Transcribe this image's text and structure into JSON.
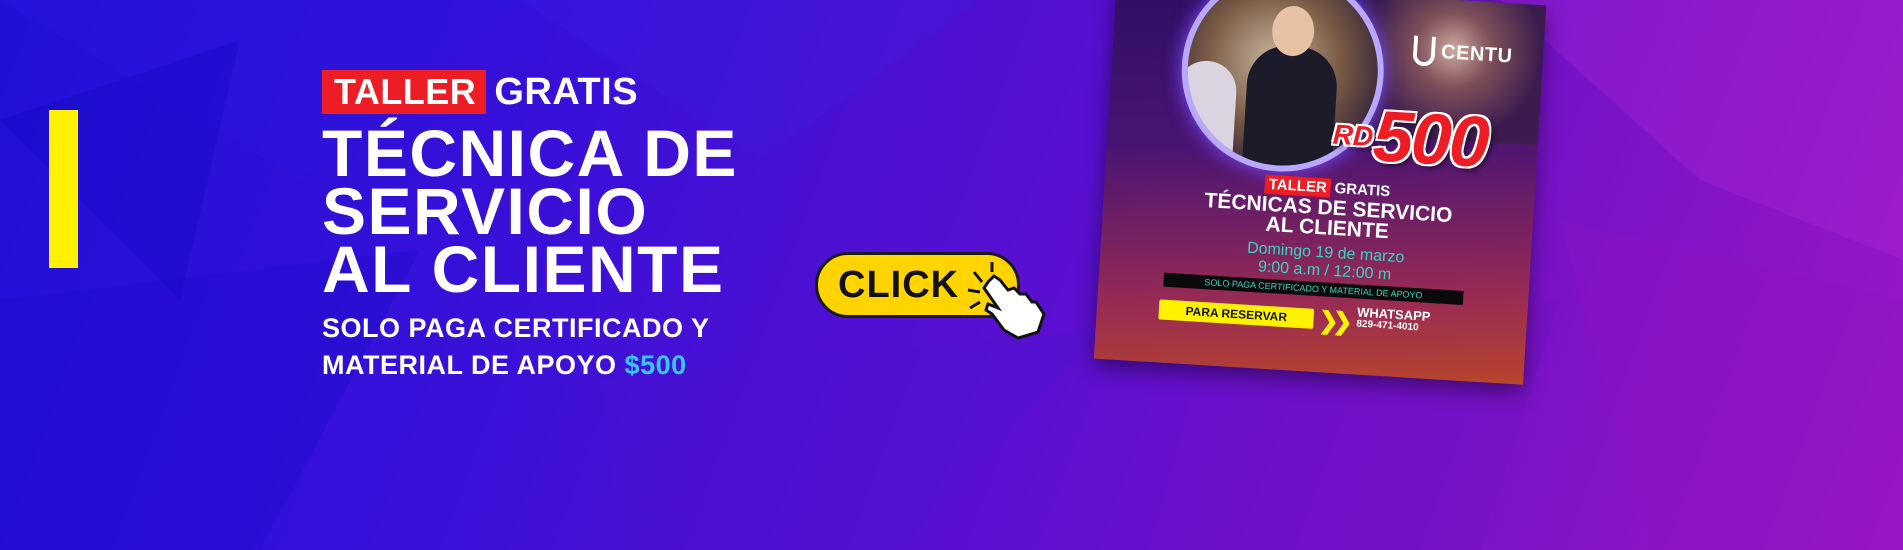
{
  "hero": {
    "tag_red": "TALLER",
    "tag_white": "GRATIS",
    "title": "TÉCNICA DE SERVICIO\nAL CLIENTE",
    "subtitle_line1": "SOLO PAGA CERTIFICADO Y",
    "subtitle_line2_prefix": "MATERIAL DE APOYO",
    "price": "$500"
  },
  "cta": {
    "label": "CLICK",
    "icon": "pointing-hand-icon"
  },
  "flyer": {
    "logo": "CENTU",
    "price_prefix": "RD",
    "price": "500",
    "tag_red": "TALLER",
    "tag_white": "GRATIS",
    "title": "TÉCNICAS DE SERVICIO\nAL CLIENTE",
    "date": "Domingo 19 de  marzo\n9:00 a.m / 12:00 m",
    "strip": "SOLO PAGA CERTIFICADO Y MATERIAL DE APOYO",
    "reserve": "PARA RESERVAR",
    "whatsapp_label": "WHATSAPP",
    "whatsapp_number": "829-471-4010"
  },
  "colors": {
    "accent_yellow": "#fff200",
    "accent_red": "#ee1c24",
    "price_blue": "#36c9ff",
    "bg_start": "#1f10d6",
    "bg_end": "#9a18c4"
  }
}
